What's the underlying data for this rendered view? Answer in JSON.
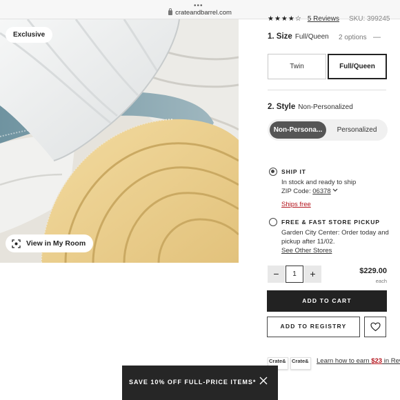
{
  "browser": {
    "url": "crateandbarrel.com"
  },
  "image": {
    "badge": "Exclusive",
    "view_room_label": "View in My Room"
  },
  "rating": {
    "stars": "★★★★☆",
    "reviews": "5 Reviews",
    "sku": "SKU: 399245"
  },
  "size": {
    "number": "1. Size",
    "selected": "Full/Queen",
    "options_count": "2 options",
    "toggle": "—",
    "buttons": [
      {
        "label": "Twin"
      },
      {
        "label": "Full/Queen"
      }
    ]
  },
  "style": {
    "number": "2. Style",
    "selected": "Non-Personalized",
    "buttons": [
      {
        "label": "Non-Persona..."
      },
      {
        "label": "Personalized"
      }
    ]
  },
  "ship": {
    "title": "SHIP IT",
    "status": "In stock and ready to ship",
    "zip_label": "ZIP Code:",
    "zip": "06378",
    "ships_free": "Ships free"
  },
  "pickup": {
    "title": "FREE & FAST STORE PICKUP",
    "line1": "Garden City Center: Order today and",
    "line2": "pickup after 11/02.",
    "other_stores": "See Other Stores"
  },
  "quantity": {
    "minus": "−",
    "value": "1",
    "plus": "+"
  },
  "price": {
    "amount": "$229.00",
    "unit": "each"
  },
  "actions": {
    "add_to_cart": "ADD TO CART",
    "add_to_registry": "ADD TO REGISTRY"
  },
  "credit": {
    "cards": [
      {
        "name": "Crate&"
      },
      {
        "name": "Crate&"
      }
    ],
    "learn_prefix": "Learn how to earn ",
    "learn_amount": "$23",
    "learn_suffix": " in Rew"
  },
  "promo": {
    "text": "SAVE 10% OFF FULL-PRICE ITEMS*"
  },
  "colors": {
    "dark": "#222222",
    "accent_red": "#b3131b",
    "toggle_active": "#555555"
  }
}
